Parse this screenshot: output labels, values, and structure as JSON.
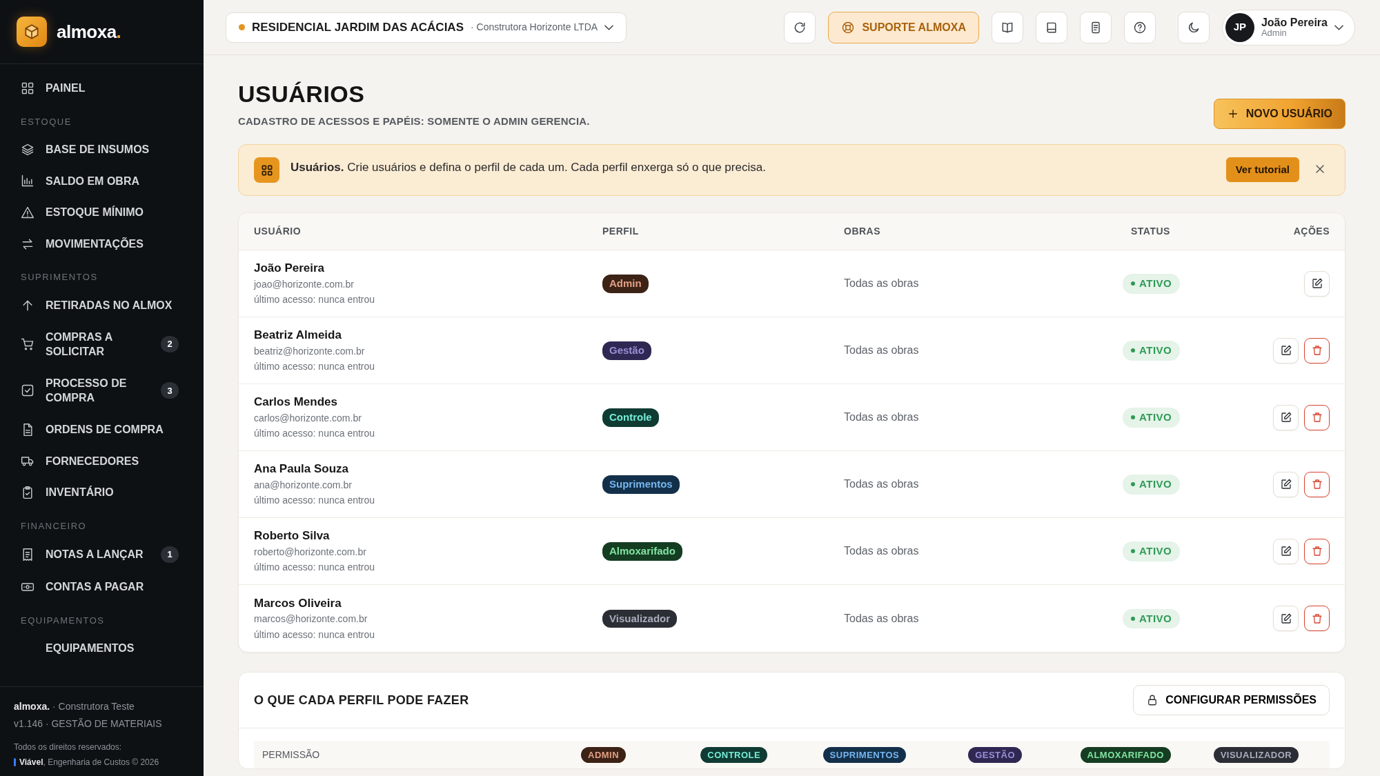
{
  "brand": {
    "name": "almoxa",
    "dot": "."
  },
  "sidebar": {
    "sections": [
      {
        "items": [
          {
            "label": "PAINEL"
          }
        ]
      },
      {
        "title": "ESTOQUE",
        "items": [
          {
            "label": "BASE DE INSUMOS"
          },
          {
            "label": "SALDO EM OBRA"
          },
          {
            "label": "ESTOQUE MÍNIMO"
          },
          {
            "label": "MOVIMENTAÇÕES"
          }
        ]
      },
      {
        "title": "SUPRIMENTOS",
        "items": [
          {
            "label": "RETIRADAS NO ALMOX"
          },
          {
            "label": "COMPRAS A SOLICITAR",
            "badge": "2"
          },
          {
            "label": "PROCESSO DE COMPRA",
            "badge": "3"
          },
          {
            "label": "ORDENS DE COMPRA"
          },
          {
            "label": "FORNECEDORES"
          },
          {
            "label": "INVENTÁRIO"
          }
        ]
      },
      {
        "title": "FINANCEIRO",
        "items": [
          {
            "label": "NOTAS A LANÇAR",
            "badge": "1"
          },
          {
            "label": "CONTAS A PAGAR"
          }
        ]
      },
      {
        "title": "EQUIPAMENTOS",
        "items": [
          {
            "label": "EQUIPAMENTOS"
          }
        ]
      }
    ],
    "footer": {
      "line_1": "**almoxa.** · Construtora Teste",
      "line_2": "v1.146 · GESTÃO DE MATERIAIS",
      "line_3": "Todos os direitos reservados:",
      "line_4": "**Viável**, Engenharia de Custos © 2026"
    }
  },
  "topbar": {
    "project": {
      "name": "RESIDENCIAL JARDIM DAS ACÁCIAS",
      "company": "· Construtora Horizonte LTDA"
    },
    "support_button": "SUPORTE ALMOXA",
    "user": {
      "initials": "JP",
      "name": "João Pereira",
      "role": "Admin"
    }
  },
  "page": {
    "title": "USUÁRIOS",
    "subtitle": "CADASTRO DE ACESSOS E PAPÉIS: SOMENTE O ADMIN GERENCIA.",
    "new_button": "NOVO USUÁRIO"
  },
  "alert": {
    "text": "**Usuários.** Crie usuários e defina o perfil de cada um. Cada perfil enxerga só o que precisa.",
    "button": "Ver tutorial"
  },
  "table": {
    "columns": [
      "USUÁRIO",
      "PERFIL",
      "OBRAS",
      "STATUS",
      "AÇÕES"
    ],
    "rows": [
      {
        "name": "João Pereira",
        "email": "joao@horizonte.com.br",
        "last_access": "último acesso: nunca entrou",
        "profile": "Admin",
        "color": "#3d2216",
        "works": "Todas as obras",
        "status": "ATIVO",
        "deletable": false
      },
      {
        "name": "Beatriz Almeida",
        "email": "beatriz@horizonte.com.br",
        "last_access": "último acesso: nunca entrou",
        "profile": "Gestão",
        "color": "#2f2853",
        "works": "Todas as obras",
        "status": "ATIVO",
        "deletable": true
      },
      {
        "name": "Carlos Mendes",
        "email": "carlos@horizonte.com.br",
        "last_access": "último acesso: nunca entrou",
        "profile": "Controle",
        "color": "#0f3b33",
        "works": "Todas as obras",
        "status": "ATIVO",
        "deletable": true
      },
      {
        "name": "Ana Paula Souza",
        "email": "ana@horizonte.com.br",
        "last_access": "último acesso: nunca entrou",
        "profile": "Suprimentos",
        "color": "#13304a",
        "works": "Todas as obras",
        "status": "ATIVO",
        "deletable": true
      },
      {
        "name": "Roberto Silva",
        "email": "roberto@horizonte.com.br",
        "last_access": "último acesso: nunca entrou",
        "profile": "Almoxarifado",
        "color": "#153d22",
        "works": "Todas as obras",
        "status": "ATIVO",
        "deletable": true
      },
      {
        "name": "Marcos Oliveira",
        "email": "marcos@horizonte.com.br",
        "last_access": "último acesso: nunca entrou",
        "profile": "Visualizador",
        "color": "#2c2e35",
        "works": "Todas as obras",
        "status": "ATIVO",
        "deletable": true
      }
    ]
  },
  "permissions": {
    "title": "O QUE CADA PERFIL PODE FAZER",
    "button": "CONFIGURAR PERMISSÕES",
    "header": "PERMISSÃO",
    "profiles": [
      {
        "label": "ADMIN",
        "color": "#3d2216"
      },
      {
        "label": "CONTROLE",
        "color": "#0f3b33"
      },
      {
        "label": "SUPRIMENTOS",
        "color": "#13304a"
      },
      {
        "label": "GESTÃO",
        "color": "#2f2853"
      },
      {
        "label": "ALMOXARIFADO",
        "color": "#153d22"
      },
      {
        "label": "VISUALIZADOR",
        "color": "#2c2e35"
      }
    ]
  }
}
